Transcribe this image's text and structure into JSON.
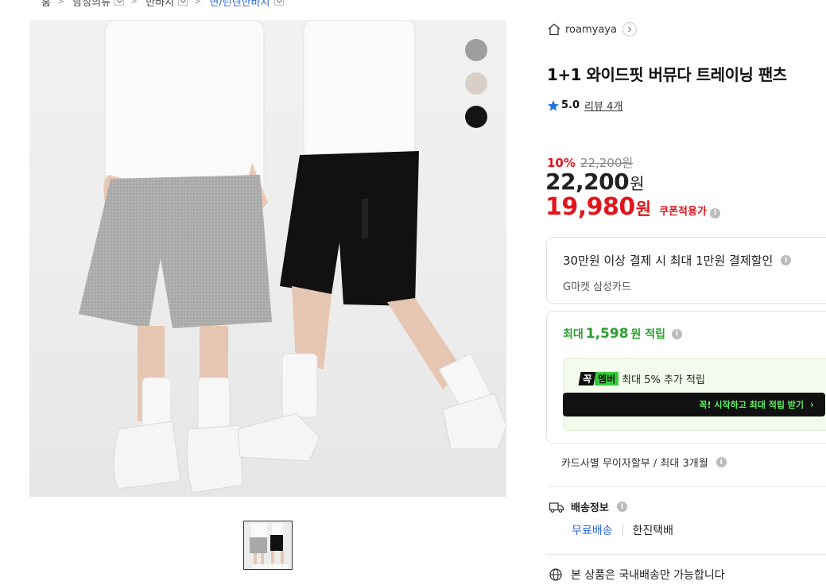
{
  "breadcrumb": {
    "items": [
      {
        "label": "홈"
      },
      {
        "label": "남성의류"
      },
      {
        "label": "반바지"
      },
      {
        "label": "면/린넨반바지"
      }
    ]
  },
  "product": {
    "color_swatches": [
      "#9e9e9e",
      "#d8d0c6",
      "#141414"
    ],
    "seller": "roamyaya",
    "title": "1+1 와이드핏 버뮤다 트레이닝 팬츠",
    "rating": "5.0",
    "review_label": "리뷰 4개"
  },
  "price": {
    "discount_rate": "10%",
    "original_price": "22,200원",
    "price_number": "22,200",
    "price_unit": "원",
    "coupon_price_number": "19,980",
    "coupon_price_unit": "원",
    "coupon_label": "쿠폰적용가"
  },
  "card_benefit": {
    "title": "30만원 이상 결제 시 최대 1만원 결제할인",
    "card": "G마켓 삼성카드"
  },
  "points": {
    "prefix": "최대",
    "amount": "1,598",
    "suffix": "원 적립",
    "member_badge_1": "꼭",
    "member_badge_2": "멤버",
    "member_text": "최대 5% 추가 적립",
    "member_cta": "꼭! 시작하고 최대 적립 받기"
  },
  "installment": "카드사별 무이자할부 / 최대 3개월",
  "shipping": {
    "title": "배송정보",
    "free": "무료배송",
    "courier": "한진택배",
    "domestic": "본 상품은 국내배송만 가능합니다"
  },
  "colors": {
    "discount_red": "#e0161d",
    "point_green": "#2aa12f",
    "link_blue": "#2a6ad8",
    "star_blue": "#1f6fe5"
  }
}
